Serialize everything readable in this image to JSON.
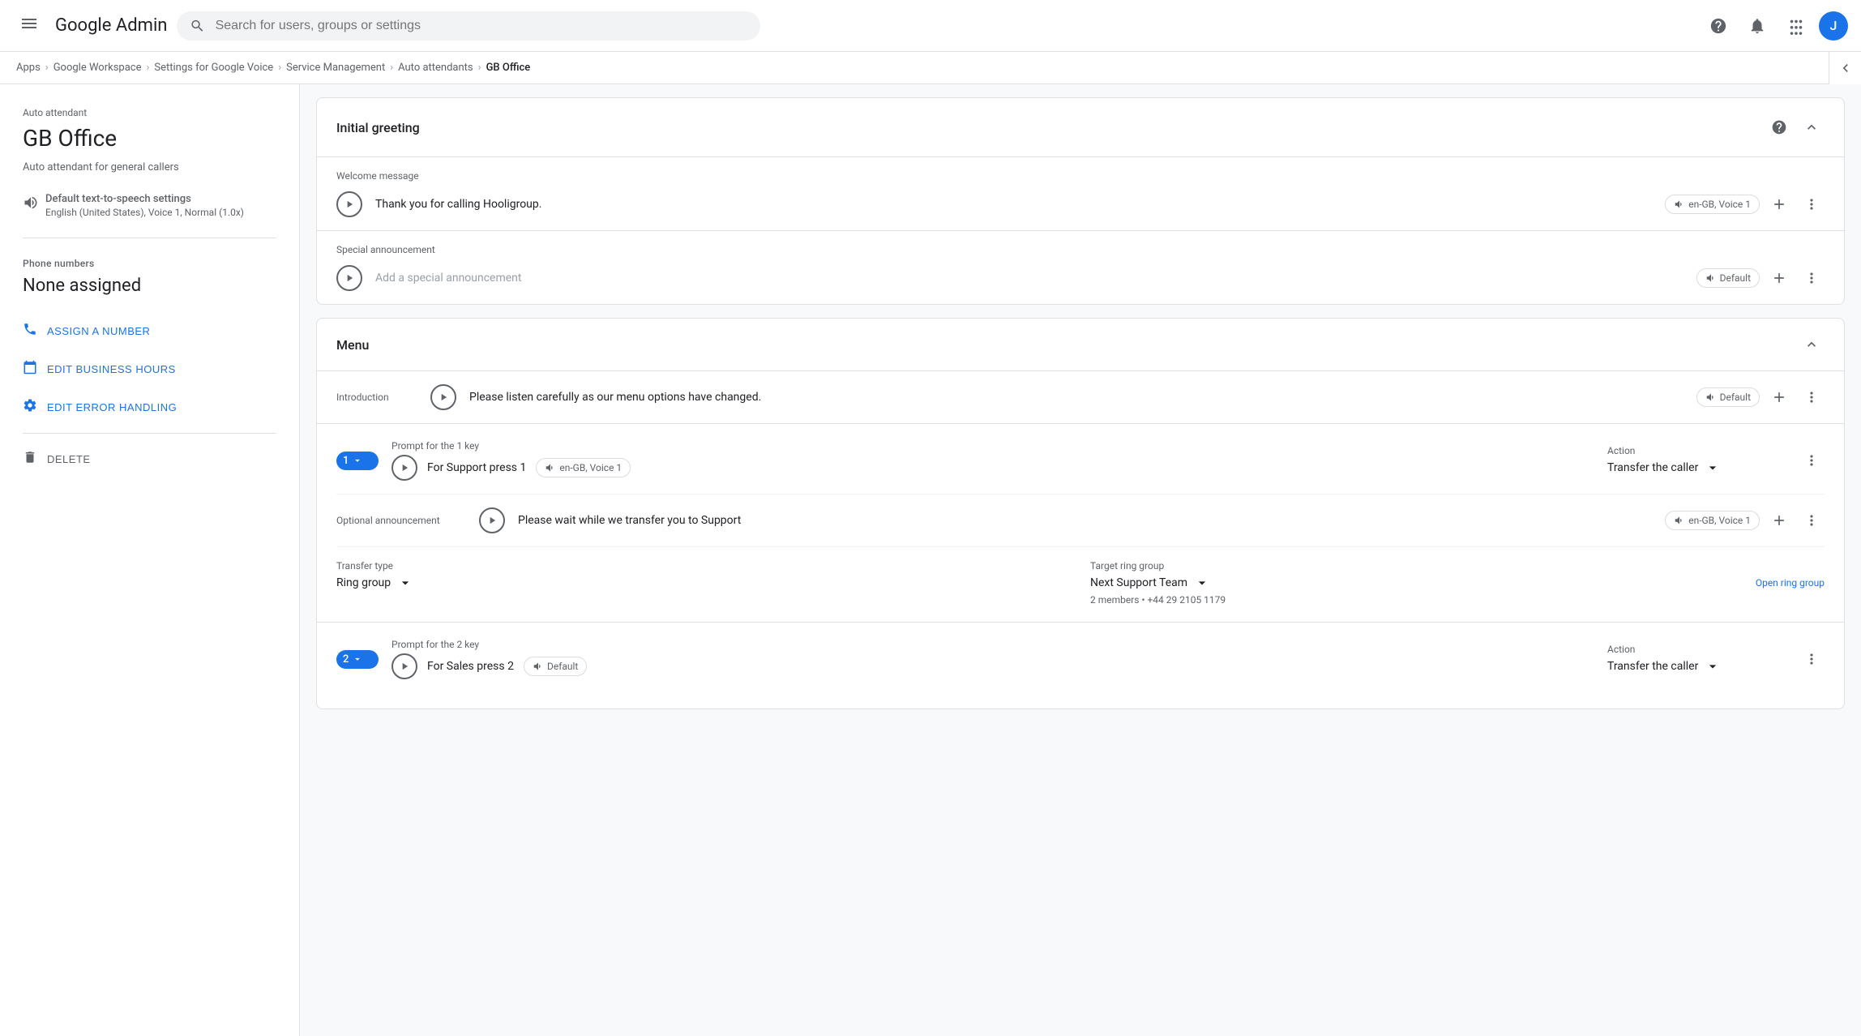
{
  "nav": {
    "hamburger": "☰",
    "logo": "Google Admin",
    "search_placeholder": "Search for users, groups or settings",
    "help_icon": "?",
    "apps_icon": "⊞",
    "avatar_letter": "J"
  },
  "breadcrumb": {
    "items": [
      "Apps",
      "Google Workspace",
      "Settings for Google Voice",
      "Service Management",
      "Auto attendants",
      "GB Office"
    ]
  },
  "sidebar": {
    "label": "Auto attendant",
    "title": "GB Office",
    "description": "Auto attendant for general callers",
    "tts_label": "Default text-to-speech settings",
    "tts_value": "English (United States), Voice 1, Normal (1.0x)",
    "phone_section_label": "Phone numbers",
    "phone_value": "None assigned",
    "actions": [
      {
        "id": "assign",
        "label": "ASSIGN A NUMBER",
        "icon": "📞"
      },
      {
        "id": "business_hours",
        "label": "EDIT BUSINESS HOURS",
        "icon": "📅"
      },
      {
        "id": "error_handling",
        "label": "EDIT ERROR HANDLING",
        "icon": "⚙"
      },
      {
        "id": "delete",
        "label": "DELETE",
        "icon": "🗑"
      }
    ]
  },
  "initial_greeting": {
    "title": "Initial greeting",
    "welcome_label": "Welcome message",
    "welcome_text": "Thank you for calling Hooligroup.",
    "welcome_voice": "en-GB, Voice 1",
    "special_label": "Special announcement",
    "special_placeholder": "Add a special announcement",
    "special_voice": "Default"
  },
  "menu": {
    "title": "Menu",
    "intro_label": "Introduction",
    "intro_text": "Please listen carefully as our menu options have changed.",
    "intro_voice": "Default",
    "key1": {
      "number": "1",
      "prompt_label": "Prompt for the 1 key",
      "prompt_text": "For Support press 1",
      "prompt_voice": "en-GB, Voice 1",
      "action_label": "Action",
      "action_value": "Transfer the caller",
      "optional_label": "Optional announcement",
      "optional_text": "Please wait while we transfer you to Support",
      "optional_voice": "en-GB, Voice 1",
      "transfer_type_label": "Transfer type",
      "transfer_type_value": "Ring group",
      "ring_group_label": "Target ring group",
      "ring_group_value": "Next Support Team",
      "ring_group_info": "2 members • +44 29 2105 1179",
      "open_ring_group": "Open ring group"
    },
    "key2": {
      "number": "2",
      "prompt_label": "Prompt for the 2 key",
      "prompt_text": "For Sales press 2",
      "prompt_voice": "Default",
      "action_label": "Action",
      "action_value": "Transfer the caller"
    }
  }
}
